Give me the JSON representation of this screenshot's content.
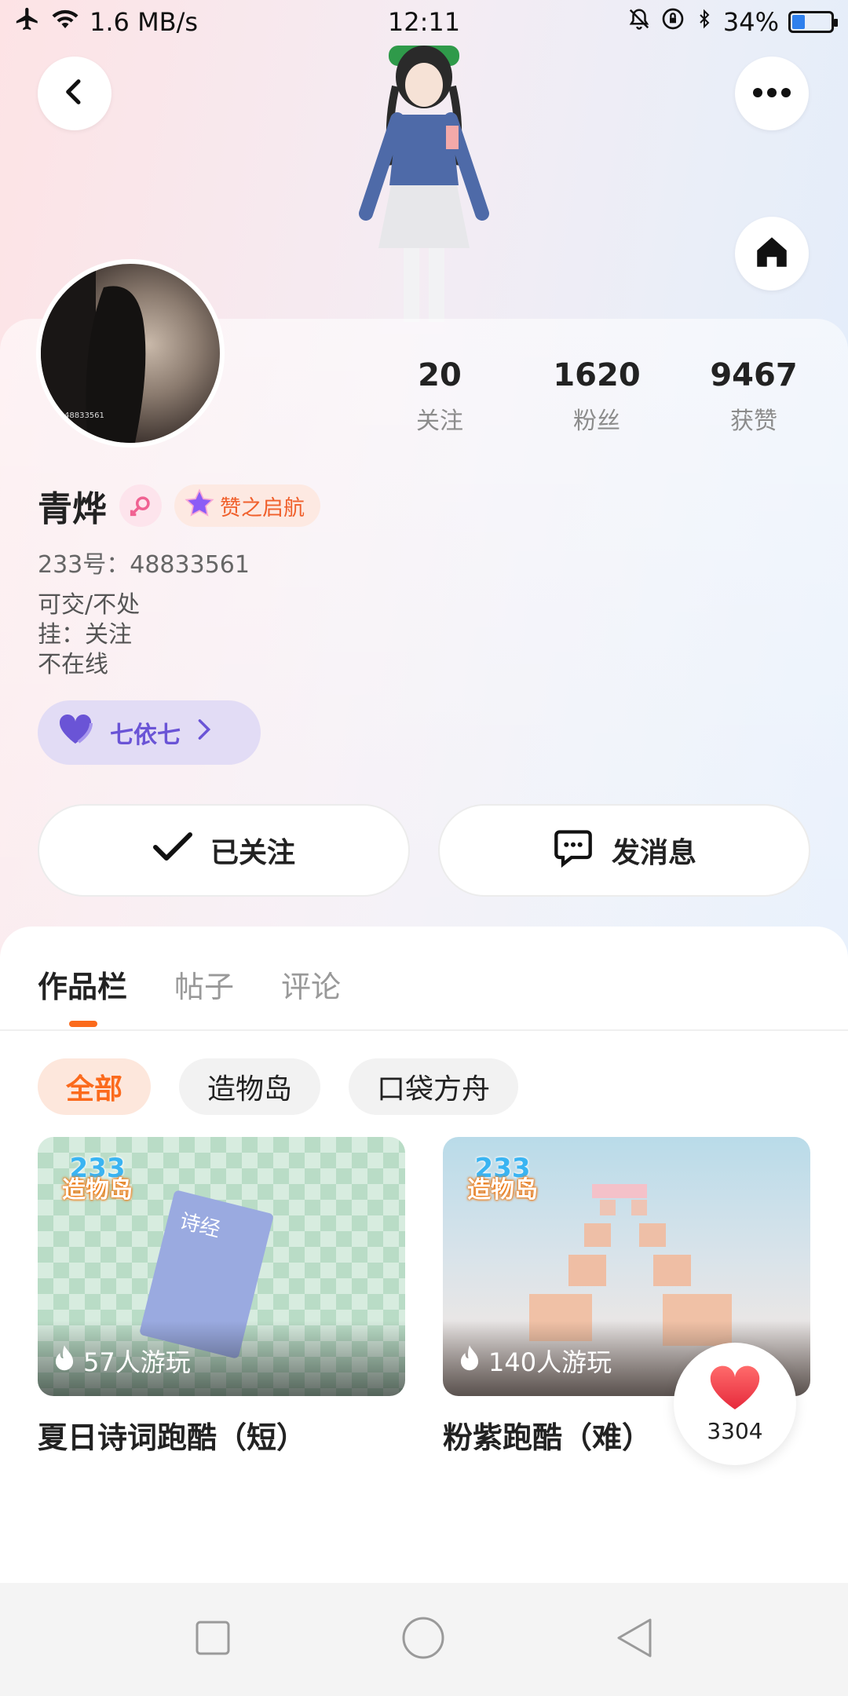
{
  "status_bar": {
    "speed": "1.6 MB/s",
    "time": "12:11",
    "battery": "34%"
  },
  "icons": {
    "back": "chevron-left-icon",
    "more": "more-dots-icon",
    "home": "home-icon",
    "gender": "female-icon",
    "badge": "star-icon",
    "cp": "heart-icon",
    "follow": "check-icon",
    "message": "chat-bubble-icon",
    "plays": "flame-icon",
    "like": "heart-icon"
  },
  "profile": {
    "stats": [
      {
        "value": "20",
        "label": "关注"
      },
      {
        "value": "1620",
        "label": "粉丝"
      },
      {
        "value": "9467",
        "label": "获赞"
      }
    ],
    "name": "青烨",
    "badge_label": "赞之启航",
    "uid": "233号：48833561",
    "bio_lines": [
      "可交/不处",
      "挂：关注",
      "不在线"
    ],
    "cp_name": "七依七",
    "avatar_text": "48833561"
  },
  "actions": {
    "follow_label": "已关注",
    "message_label": "发消息"
  },
  "tabs": [
    "作品栏",
    "帖子",
    "评论"
  ],
  "filters": [
    "全部",
    "造物岛",
    "口袋方舟"
  ],
  "works": [
    {
      "title": "夏日诗词跑酷（短）",
      "plays": "57人游玩",
      "logo_top": "233",
      "logo_bottom": "造物岛",
      "book_text": "诗经"
    },
    {
      "title": "粉紫跑酷（难）",
      "plays": "140人游玩",
      "logo_top": "233",
      "logo_bottom": "造物岛"
    }
  ],
  "like_count": "3304",
  "colors": {
    "accent": "#fb6a1c",
    "cp_purple": "#6a54d6",
    "heart_red": "#f0394a"
  }
}
